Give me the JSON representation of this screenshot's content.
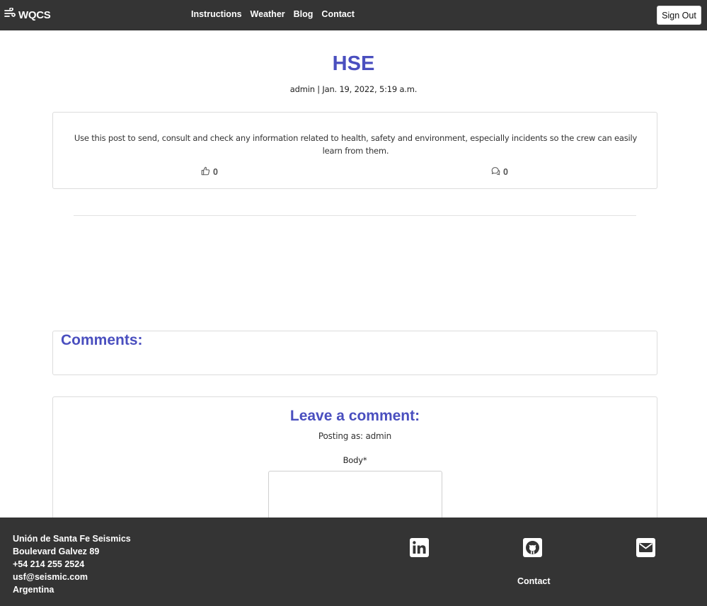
{
  "navbar": {
    "brand": "WQCS",
    "links": [
      "Instructions",
      "Weather",
      "Blog",
      "Contact"
    ],
    "signout_label": "Sign Out"
  },
  "post": {
    "title": "HSE",
    "meta": "admin | Jan. 19, 2022, 5:19 a.m.",
    "body": "Use this post to send, consult and check any information related to health, safety and environment, especially incidents so the crew can easily learn from them.",
    "likes": "0",
    "comments": "0"
  },
  "comments_section": {
    "title": "Comments:"
  },
  "leave_comment": {
    "title": "Leave a comment:",
    "posting_as": "Posting as: admin",
    "body_label": "Body*"
  },
  "footer": {
    "address": [
      "Unión de Santa Fe Seismics",
      "Boulevard Galvez 89",
      "+54 214 255 2524",
      "usf@seismic.com",
      "Argentina"
    ],
    "contact_label": "Contact",
    "icons": [
      "linkedin-icon",
      "github-icon",
      "envelope-icon"
    ]
  },
  "colors": {
    "accent": "#4a4fbf",
    "navbar_bg": "#343434",
    "footer_bg": "#343434"
  }
}
